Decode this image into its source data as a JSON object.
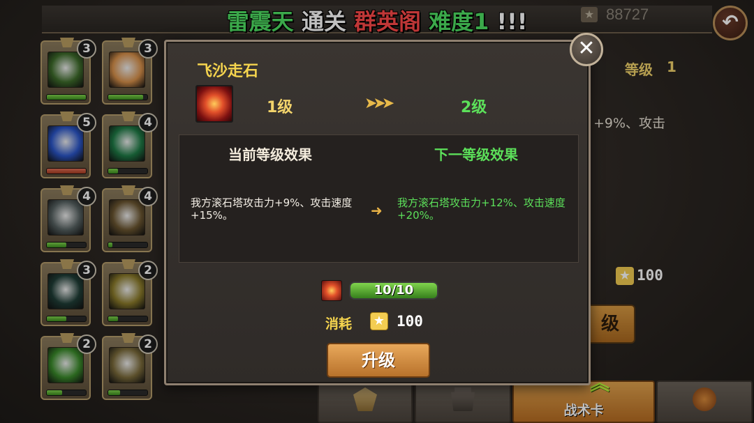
{
  "banner": {
    "part1": "雷震天",
    "part2": "通关",
    "part3": "群英阁",
    "part4": "难度1",
    "part5": "!!!"
  },
  "header": {
    "coins": "88727",
    "coin_icon": "star-icon",
    "back_icon": "back-arrow-icon"
  },
  "cards": [
    {
      "count": "3",
      "progress": 1.0,
      "bar": "green",
      "art": "#3d6b2a"
    },
    {
      "count": "3",
      "progress": 0.9,
      "bar": "green",
      "art": "#d7904a"
    },
    {
      "count": "5",
      "progress": 1.0,
      "bar": "red",
      "art": "#2a55c8"
    },
    {
      "count": "4",
      "progress": 0.25,
      "bar": "green",
      "art": "#1e7a45"
    },
    {
      "count": "4",
      "progress": 0.5,
      "bar": "green",
      "art": "#556060"
    },
    {
      "count": "4",
      "progress": 0.1,
      "bar": "green",
      "art": "#6a5530"
    },
    {
      "count": "3",
      "progress": 0.5,
      "bar": "green",
      "art": "#1f3d36"
    },
    {
      "count": "2",
      "progress": 0.25,
      "bar": "green",
      "art": "#8a7a2a"
    },
    {
      "count": "2",
      "progress": 0.4,
      "bar": "green",
      "art": "#3a8a2a"
    },
    {
      "count": "2",
      "progress": 0.3,
      "bar": "green",
      "art": "#7a6a3a"
    }
  ],
  "right_panel": {
    "level_label": "等级",
    "level_value": "1",
    "effect_text": "+9%、攻击",
    "cost": "100",
    "button_partial": "级"
  },
  "tabs": [
    {
      "label": "",
      "icon": "shield-emblem-icon"
    },
    {
      "label": "",
      "icon": "tower-icon"
    },
    {
      "label": "战术卡",
      "icon": "tactic-card-icon",
      "active": true
    },
    {
      "label": "",
      "icon": "axe-icon"
    }
  ],
  "modal": {
    "title": "飞沙走石",
    "level_from": "1级",
    "level_to": "2级",
    "current_header": "当前等级效果",
    "next_header": "下一等级效果",
    "current_effect": "我方滚石塔攻击力+9%、攻击速度+15%。",
    "next_effect": "我方滚石塔攻击力+12%、攻击速度+20%。",
    "progress_text": "10/10",
    "progress": 1.0,
    "cost_label": "消耗",
    "cost_value": "100",
    "upgrade_label": "升级",
    "close_icon": "close-icon",
    "arrow_icon": "triple-chevron-right-icon"
  },
  "colors": {
    "gold_text": "#f5d44e",
    "green_text": "#5ce05a",
    "button_orange": "#d89a43"
  }
}
